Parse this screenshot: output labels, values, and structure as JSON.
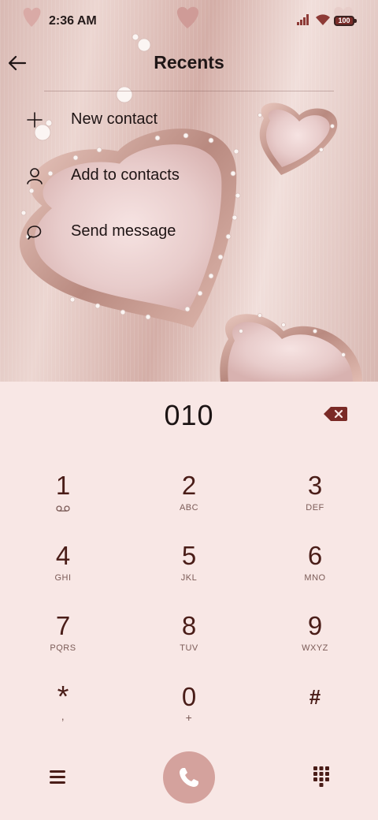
{
  "status_bar": {
    "time": "2:36 AM",
    "battery": "100"
  },
  "header": {
    "title": "Recents"
  },
  "menu": [
    {
      "label": "New contact",
      "icon": "plus-icon"
    },
    {
      "label": "Add to contacts",
      "icon": "person-icon"
    },
    {
      "label": "Send message",
      "icon": "message-bubble-icon"
    }
  ],
  "dial": {
    "number": "010"
  },
  "keys": [
    {
      "digit": "1",
      "letters": ""
    },
    {
      "digit": "2",
      "letters": "ABC"
    },
    {
      "digit": "3",
      "letters": "DEF"
    },
    {
      "digit": "4",
      "letters": "GHI"
    },
    {
      "digit": "5",
      "letters": "JKL"
    },
    {
      "digit": "6",
      "letters": "MNO"
    },
    {
      "digit": "7",
      "letters": "PQRS"
    },
    {
      "digit": "8",
      "letters": "TUV"
    },
    {
      "digit": "9",
      "letters": "WXYZ"
    },
    {
      "digit": "*",
      "letters": ","
    },
    {
      "digit": "0",
      "letters": "+"
    },
    {
      "digit": "#",
      "letters": ""
    }
  ],
  "colors": {
    "accent": "#4a1d18",
    "call_button": "#d4a29d",
    "pad_background": "#f8e7e5"
  }
}
